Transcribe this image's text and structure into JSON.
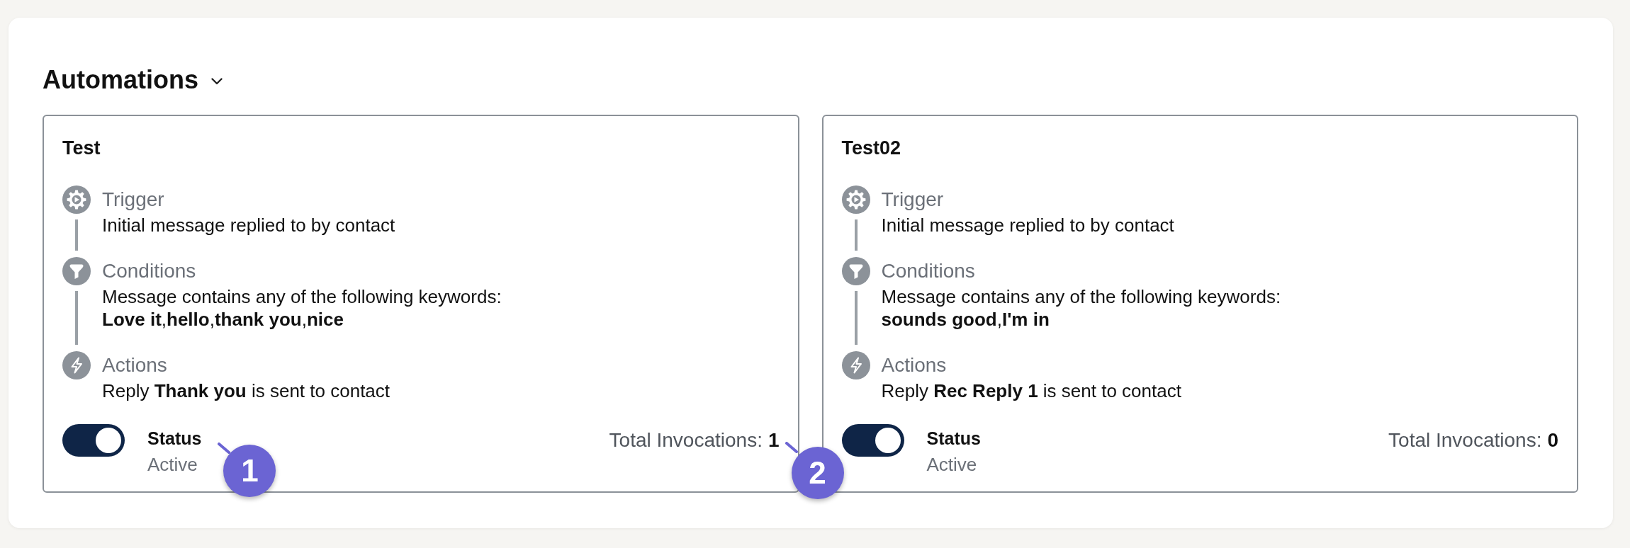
{
  "header": {
    "title": "Automations"
  },
  "automations": [
    {
      "name": "Test",
      "steps": [
        {
          "kind": "trigger",
          "label": "Trigger",
          "lines": [
            "Initial message replied to by contact"
          ]
        },
        {
          "kind": "conditions",
          "label": "Conditions",
          "lines": [
            "Message contains any of the following keywords:",
            "**Love it**,**hello**,**thank you**,**nice**"
          ]
        },
        {
          "kind": "actions",
          "label": "Actions",
          "lines": [
            "Reply **Thank you** is sent to contact"
          ]
        }
      ],
      "status": {
        "label": "Status",
        "on": true,
        "value": "Active",
        "callout": "1"
      },
      "invocations": {
        "label": "Total Invocations:",
        "count": "1",
        "callout": "2"
      }
    },
    {
      "name": "Test02",
      "steps": [
        {
          "kind": "trigger",
          "label": "Trigger",
          "lines": [
            "Initial message replied to by contact"
          ]
        },
        {
          "kind": "conditions",
          "label": "Conditions",
          "lines": [
            "Message contains any of the following keywords:",
            "**sounds good**,**I'm in**"
          ]
        },
        {
          "kind": "actions",
          "label": "Actions",
          "lines": [
            "Reply **Rec Reply 1** is sent to contact"
          ]
        }
      ],
      "status": {
        "label": "Status",
        "on": true,
        "value": "Active"
      },
      "invocations": {
        "label": "Total Invocations:",
        "count": "0"
      }
    }
  ]
}
